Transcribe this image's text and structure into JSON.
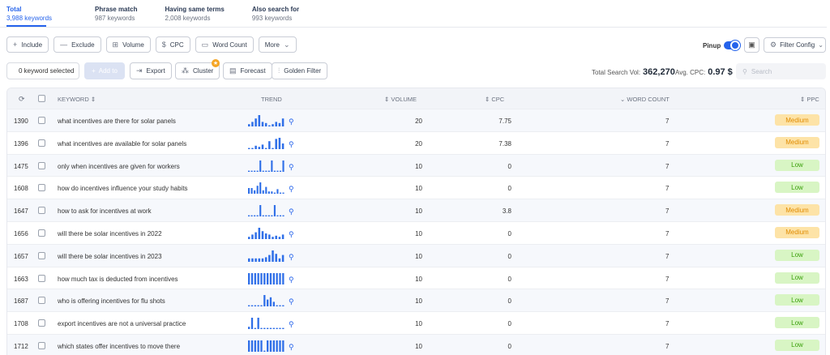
{
  "tabs": [
    {
      "title": "Total",
      "count": "3,988 keywords"
    },
    {
      "title": "Phrase match",
      "count": "987 keywords"
    },
    {
      "title": "Having same terms",
      "count": "2,008 keywords"
    },
    {
      "title": "Also search for",
      "count": "993 keywords"
    }
  ],
  "filters": {
    "include": "Include",
    "exclude": "Exclude",
    "volume": "Volume",
    "cpc": "CPC",
    "word_count": "Word Count",
    "more": "More"
  },
  "pinup_label": "Pinup",
  "filter_config_label": "Filter Config",
  "actions": {
    "keyword_selected": "0 keyword selected",
    "add_to": "Add to",
    "export": "Export",
    "cluster": "Cluster",
    "forecast": "Forecast",
    "golden_filter": "Golden Filter"
  },
  "stats": {
    "total_search_vol_label": "Total Search Vol:",
    "total_search_vol_value": "362,270",
    "avg_cpc_label": "Avg. CPC:",
    "avg_cpc_value": "0.97 $"
  },
  "search": {
    "placeholder": "Search"
  },
  "table": {
    "headers": {
      "keyword": "KEYWORD",
      "trend": "TREND",
      "volume": "VOLUME",
      "cpc": "CPC",
      "word_count": "WORD COUNT",
      "ppc": "PPC"
    },
    "rows": [
      {
        "id": "1390",
        "keyword": "what incentives are there for solar panels",
        "trend": [
          2,
          4,
          7,
          10,
          4,
          3,
          1,
          2,
          4,
          3,
          7
        ],
        "volume": "20",
        "cpc": "7.75",
        "word_count": "7",
        "ppc": "Medium"
      },
      {
        "id": "1396",
        "keyword": "what incentives are available for solar panels",
        "trend": [
          1,
          1,
          3,
          2,
          4,
          1,
          7,
          1,
          9,
          10,
          5
        ],
        "volume": "20",
        "cpc": "7.38",
        "word_count": "7",
        "ppc": "Medium"
      },
      {
        "id": "1475",
        "keyword": "only when incentives are given for workers",
        "trend": [
          1,
          1,
          1,
          1,
          10,
          1,
          1,
          1,
          10,
          1,
          1,
          1,
          10
        ],
        "volume": "10",
        "cpc": "0",
        "word_count": "7",
        "ppc": "Low"
      },
      {
        "id": "1608",
        "keyword": "how do incentives influence your study habits",
        "trend": [
          5,
          5,
          3,
          7,
          10,
          3,
          6,
          2,
          2,
          1,
          4,
          1,
          1
        ],
        "volume": "10",
        "cpc": "0",
        "word_count": "7",
        "ppc": "Low"
      },
      {
        "id": "1647",
        "keyword": "how to ask for incentives at work",
        "trend": [
          1,
          1,
          1,
          1,
          10,
          1,
          1,
          1,
          1,
          10,
          1,
          1,
          1
        ],
        "volume": "10",
        "cpc": "3.8",
        "word_count": "7",
        "ppc": "Medium"
      },
      {
        "id": "1656",
        "keyword": "will there be solar incentives in 2022",
        "trend": [
          2,
          4,
          6,
          10,
          7,
          5,
          4,
          2,
          3,
          2,
          4
        ],
        "volume": "10",
        "cpc": "0",
        "word_count": "7",
        "ppc": "Medium"
      },
      {
        "id": "1657",
        "keyword": "will there be solar incentives in 2023",
        "trend": [
          3,
          3,
          3,
          3,
          3,
          4,
          6,
          10,
          7,
          3,
          6
        ],
        "volume": "10",
        "cpc": "0",
        "word_count": "7",
        "ppc": "Low"
      },
      {
        "id": "1663",
        "keyword": "how much tax is deducted from incentives",
        "trend": [
          7,
          7,
          7,
          7,
          7,
          7,
          7,
          7,
          7,
          7,
          7,
          7
        ],
        "volume": "10",
        "cpc": "0",
        "word_count": "7",
        "ppc": "Low"
      },
      {
        "id": "1687",
        "keyword": "who is offering incentives for flu shots",
        "trend": [
          1,
          1,
          1,
          1,
          1,
          10,
          6,
          8,
          4,
          1,
          1,
          1
        ],
        "volume": "10",
        "cpc": "0",
        "word_count": "7",
        "ppc": "Low"
      },
      {
        "id": "1708",
        "keyword": "export incentives are not a universal practice",
        "trend": [
          2,
          10,
          1,
          10,
          1,
          1,
          1,
          1,
          1,
          1,
          1,
          1
        ],
        "volume": "10",
        "cpc": "0",
        "word_count": "7",
        "ppc": "Low"
      },
      {
        "id": "1712",
        "keyword": "which states offer incentives to move there",
        "trend": [
          10,
          10,
          10,
          10,
          10,
          1,
          10,
          10,
          10,
          10,
          10,
          10
        ],
        "volume": "10",
        "cpc": "0",
        "word_count": "7",
        "ppc": "Low"
      }
    ]
  },
  "colors": {
    "accent": "#2563eb",
    "medium_bg": "#fde3a7",
    "medium_text": "#e08b00",
    "low_bg": "#d8f5c4",
    "low_text": "#3aa00b",
    "bar": "#2f6fe8"
  }
}
